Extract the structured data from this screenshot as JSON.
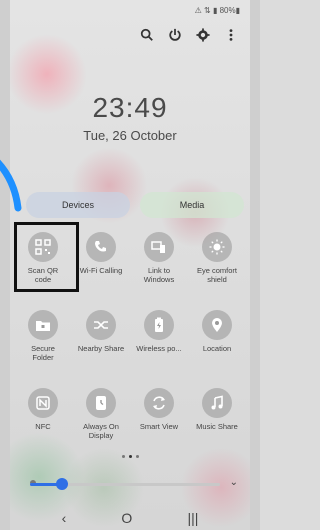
{
  "status": {
    "text": "⚠ ⇅ ▮ 80%▮"
  },
  "top_actions": {
    "search": "search-icon",
    "power": "power-icon",
    "settings": "gear-icon",
    "more": "more-vertical-icon"
  },
  "clock": {
    "time": "23:49",
    "date": "Tue, 26 October"
  },
  "buttons": {
    "devices": "Devices",
    "media": "Media"
  },
  "tiles": [
    {
      "label": "Scan QR\ncode",
      "icon": "qr-icon"
    },
    {
      "label": "Wi-Fi Calling",
      "icon": "wifi-call-icon"
    },
    {
      "label": "Link to\nWindows",
      "icon": "link-windows-icon"
    },
    {
      "label": "Eye comfort\nshield",
      "icon": "eye-comfort-icon"
    },
    {
      "label": "Secure\nFolder",
      "icon": "secure-folder-icon"
    },
    {
      "label": "Nearby Share",
      "icon": "nearby-share-icon"
    },
    {
      "label": "Wireless po...",
      "icon": "wireless-power-icon"
    },
    {
      "label": "Location",
      "icon": "location-icon"
    },
    {
      "label": "NFC",
      "icon": "nfc-icon"
    },
    {
      "label": "Always On\nDisplay",
      "icon": "always-on-display-icon"
    },
    {
      "label": "Smart View",
      "icon": "smart-view-icon"
    },
    {
      "label": "Music Share",
      "icon": "music-share-icon"
    }
  ],
  "pager": {
    "pages": 3,
    "current": 2
  },
  "brightness": {
    "level": 0.1
  },
  "nav": {
    "back": "‹",
    "home": "O",
    "recents": "|||"
  },
  "colors": {
    "accent": "#2f6fe6",
    "highlight_border": "#111111"
  }
}
